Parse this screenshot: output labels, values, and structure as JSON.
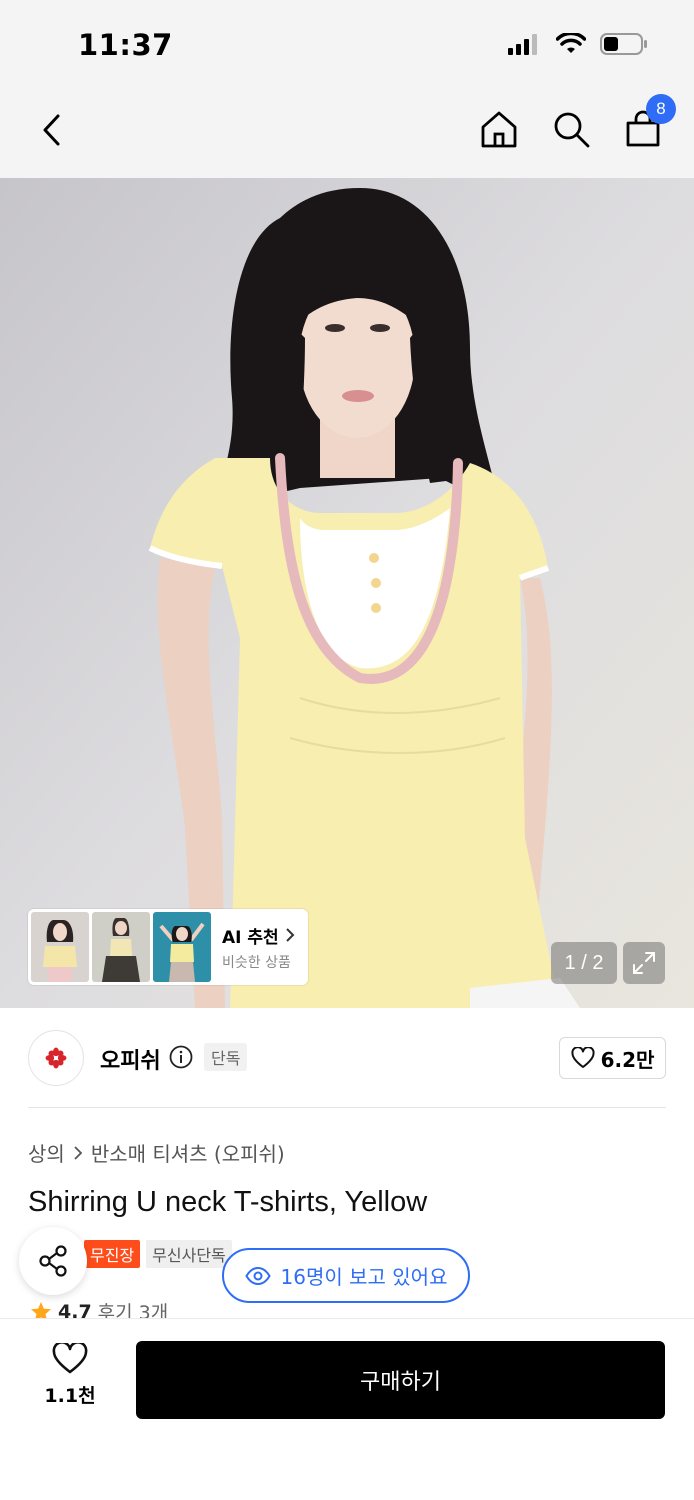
{
  "status_bar": {
    "time": "11:37"
  },
  "nav": {
    "cart_count": "8"
  },
  "hero": {
    "page_indicator": "1 / 2",
    "ai_card": {
      "title": "AI 추천",
      "subtitle": "비슷한 상품"
    }
  },
  "brand": {
    "name": "오피쉬",
    "tag": "단독",
    "likes": "6.2만"
  },
  "product": {
    "breadcrumb": [
      "상의",
      "반소매 티셔츠 (오피쉬)"
    ],
    "title": "Shirring U neck T-shirts, Yellow",
    "badges": [
      "무진장",
      "무신사단독"
    ],
    "rating": "4.7",
    "reviews": "후기 3개",
    "viewers": "16명이 보고 있어요"
  },
  "bottom_bar": {
    "likes": "1.1천",
    "buy_label": "구매하기"
  },
  "colors": {
    "accent": "#2f6df6",
    "badge_red": "#ff4c1b",
    "buy_button": "#000000",
    "shirt": "#f7eeb0"
  }
}
